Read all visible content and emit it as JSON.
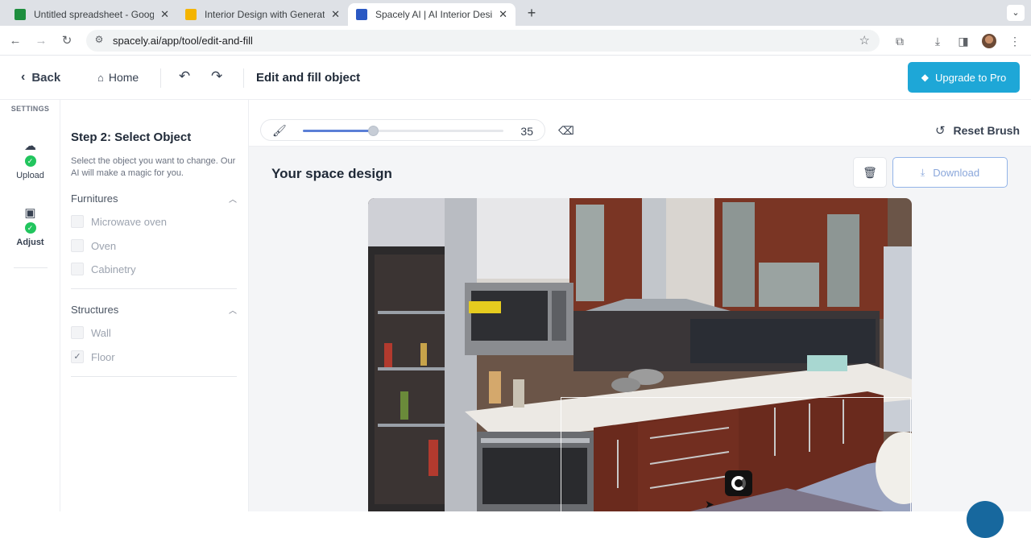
{
  "browser": {
    "tabs": [
      {
        "title": "Untitled spreadsheet - Googl",
        "icon": "sheets-icon",
        "color": "#1e8e3e"
      },
      {
        "title": "Interior Design with Generativ",
        "icon": "slides-icon",
        "color": "#f4b400"
      },
      {
        "title": "Spacely AI | AI Interior Design",
        "icon": "spacely-icon",
        "color": "#2b59c3"
      }
    ],
    "url": "spacely.ai/app/tool/edit-and-fill"
  },
  "header": {
    "back_label": "Back",
    "home_label": "Home",
    "title": "Edit and fill object",
    "upgrade_label": "Upgrade to Pro"
  },
  "rail": {
    "settings_label": "SETTINGS",
    "steps": [
      {
        "label": "Upload",
        "icon": "cloud-upload-icon",
        "done": true
      },
      {
        "label": "Adjust",
        "icon": "adjust-image-icon",
        "done": true
      }
    ]
  },
  "panel": {
    "step_title": "Step 2: Select Object",
    "description": "Select the object you want to change. Our AI will make a magic for you.",
    "groups": [
      {
        "name": "Furnitures",
        "items": [
          {
            "label": "Microwave oven",
            "checked": false
          },
          {
            "label": "Oven",
            "checked": false
          },
          {
            "label": "Cabinetry",
            "checked": false
          }
        ]
      },
      {
        "name": "Structures",
        "items": [
          {
            "label": "Wall",
            "checked": false
          },
          {
            "label": "Floor",
            "checked": true
          }
        ]
      }
    ]
  },
  "toolbar": {
    "brush_size": "35",
    "brush_fraction": 0.35,
    "reset_label": "Reset Brush"
  },
  "canvas": {
    "title": "Your space design",
    "download_label": "Download"
  },
  "colors": {
    "accent": "#1ea7d7",
    "check": "#22c55e",
    "slider": "#5b7fd6"
  }
}
